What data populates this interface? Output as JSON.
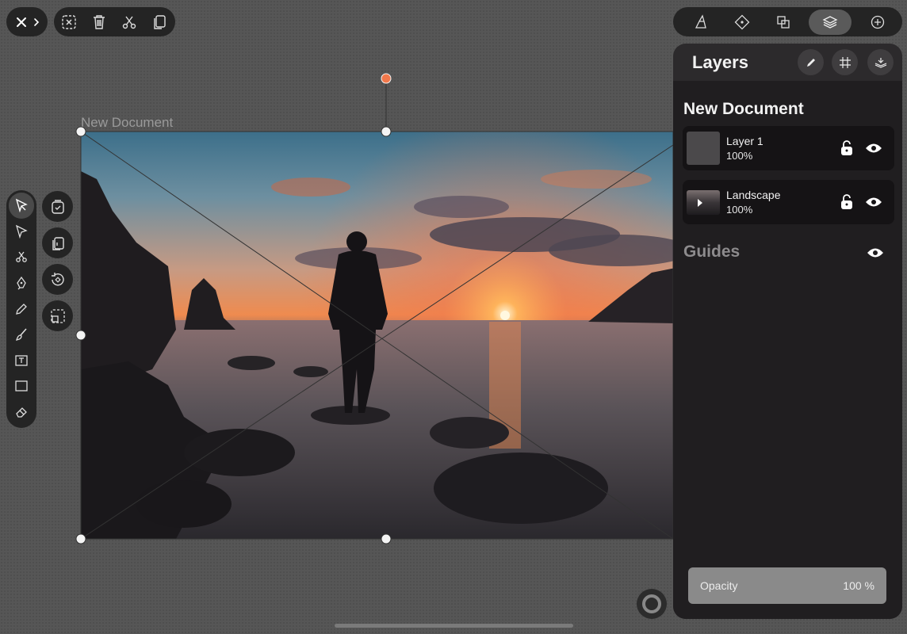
{
  "canvas": {
    "document_label": "New Document",
    "icons": [
      "mountain-rock-left",
      "sea-stack",
      "person-silhouette",
      "sun",
      "rocks-foreground"
    ]
  },
  "top_left": {
    "close_icon": "close-icon",
    "expand_icon": "chevron-right-icon",
    "tools": [
      "deselect-icon",
      "trash-icon",
      "scissors-icon",
      "copy-icon"
    ]
  },
  "left_toolbar": {
    "tools": [
      "select-arrow",
      "direct-select-arrow",
      "scissors",
      "pen",
      "pencil",
      "brush",
      "text",
      "rectangle",
      "eraser"
    ],
    "active_tool": "select-arrow",
    "context_tools": [
      "clipboard-check",
      "paste",
      "rotate",
      "transform-box"
    ]
  },
  "right_top": {
    "tools": [
      "style-brush-icon",
      "node-icon",
      "boolean-icon",
      "layers-icon",
      "add-icon"
    ],
    "active_tool": "layers-icon"
  },
  "panel": {
    "title": "Layers",
    "header_buttons": [
      "edit-icon",
      "grid-icon",
      "stack-download-icon"
    ],
    "document_name": "New Document",
    "layers": [
      {
        "name": "Layer 1",
        "opacity": "100%",
        "locked": false,
        "visible": true
      },
      {
        "name": "Landscape",
        "opacity": "100%",
        "locked": false,
        "visible": true
      }
    ],
    "guides_label": "Guides",
    "opacity_label": "Opacity",
    "opacity_value": "100 %"
  },
  "colors": {
    "accent_handle": "#f2784b",
    "panel_bg": "#2c2a2c",
    "toolbar_bg": "#242424"
  }
}
